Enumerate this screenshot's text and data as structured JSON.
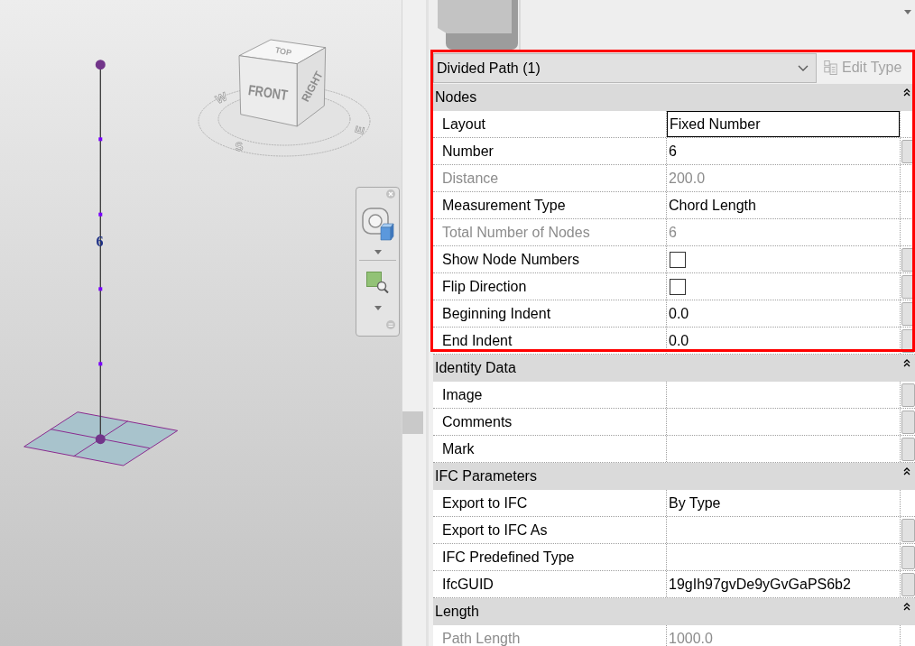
{
  "viewport": {
    "node_count_label": "6",
    "view_cube": {
      "top_label": "TOP",
      "front_label": "FRONT",
      "right_label": "RIGHT",
      "compass": [
        "W",
        "S",
        "E"
      ]
    }
  },
  "properties": {
    "type_selector": {
      "value": "Divided Path (1)",
      "highlighted": true
    },
    "edit_type_button": {
      "label": "Edit Type",
      "disabled": true
    },
    "groups": [
      {
        "title": "Nodes",
        "expanded": true,
        "highlighted": true,
        "rows": [
          {
            "name": "Layout",
            "kind": "text",
            "value": "Fixed Number",
            "focused": true,
            "disabled": false,
            "param_button": false
          },
          {
            "name": "Number",
            "kind": "text",
            "value": "6",
            "focused": false,
            "disabled": false,
            "param_button": true
          },
          {
            "name": "Distance",
            "kind": "text",
            "value": "200.0",
            "focused": false,
            "disabled": true,
            "param_button": false
          },
          {
            "name": "Measurement Type",
            "kind": "text",
            "value": "Chord Length",
            "focused": false,
            "disabled": false,
            "param_button": false
          },
          {
            "name": "Total Number of Nodes",
            "kind": "text",
            "value": "6",
            "focused": false,
            "disabled": true,
            "param_button": false
          },
          {
            "name": "Show Node Numbers",
            "kind": "checkbox",
            "checked": false,
            "focused": false,
            "disabled": false,
            "param_button": true
          },
          {
            "name": "Flip Direction",
            "kind": "checkbox",
            "checked": false,
            "focused": false,
            "disabled": false,
            "param_button": true
          },
          {
            "name": "Beginning Indent",
            "kind": "text",
            "value": "0.0",
            "focused": false,
            "disabled": false,
            "param_button": true
          },
          {
            "name": "End Indent",
            "kind": "text",
            "value": "0.0",
            "focused": false,
            "disabled": false,
            "param_button": true
          }
        ]
      },
      {
        "title": "Identity Data",
        "expanded": true,
        "highlighted": false,
        "rows": [
          {
            "name": "Image",
            "kind": "text",
            "focused": false,
            "disabled": false,
            "param_button": true
          },
          {
            "name": "Comments",
            "kind": "text",
            "focused": false,
            "disabled": false,
            "param_button": true
          },
          {
            "name": "Mark",
            "kind": "text",
            "focused": false,
            "disabled": false,
            "param_button": true
          }
        ]
      },
      {
        "title": "IFC Parameters",
        "expanded": true,
        "highlighted": false,
        "rows": [
          {
            "name": "Export to IFC",
            "kind": "text",
            "value": "By Type",
            "focused": false,
            "disabled": false,
            "param_button": false
          },
          {
            "name": "Export to IFC As",
            "kind": "text",
            "focused": false,
            "disabled": false,
            "param_button": true
          },
          {
            "name": "IFC Predefined Type",
            "kind": "text",
            "focused": false,
            "disabled": false,
            "param_button": true
          },
          {
            "name": "IfcGUID",
            "kind": "text",
            "value": "19gIh97gvDe9yGvGaPS6b2",
            "focused": false,
            "disabled": false,
            "param_button": true
          }
        ]
      },
      {
        "title": "Length",
        "expanded": true,
        "highlighted": false,
        "rows": [
          {
            "name": "Path Length",
            "kind": "text",
            "value": "1000.0",
            "focused": false,
            "disabled": true,
            "param_button": false
          }
        ]
      }
    ]
  }
}
